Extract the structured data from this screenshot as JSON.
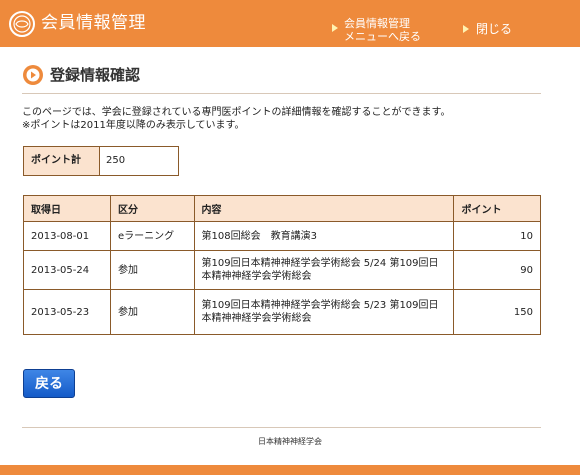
{
  "header": {
    "app_title": "会員情報管理",
    "nav_menu_line1": "会員情報管理",
    "nav_menu_line2": "メニューへ戻る",
    "nav_close": "閉じる"
  },
  "page": {
    "title": "登録情報確認",
    "desc_line1": "このページでは、学会に登録されている専門医ポイントの詳細情報を確認することができます。",
    "desc_line2": "※ポイントは2011年度以降のみ表示しています。"
  },
  "summary": {
    "label": "ポイント計",
    "value": "250"
  },
  "table": {
    "headers": {
      "date": "取得日",
      "kind": "区分",
      "content": "内容",
      "points": "ポイント"
    },
    "rows": [
      {
        "date": "2013-08-01",
        "kind": "eラーニング",
        "content": "第108回総会　教育講演3",
        "points": "10"
      },
      {
        "date": "2013-05-24",
        "kind": "参加",
        "content": "第109回日本精神神経学会学術総会 5/24 第109回日本精神神経学会学術総会",
        "points": "90"
      },
      {
        "date": "2013-05-23",
        "kind": "参加",
        "content": "第109回日本精神神経学会学術総会 5/23 第109回日本精神神経学会学術総会",
        "points": "150"
      }
    ]
  },
  "buttons": {
    "back": "戻る"
  },
  "footer": {
    "text": "日本精神神経学会"
  },
  "colors": {
    "header_bg": "#ee8a3c",
    "table_header_bg": "#fbe3cf",
    "table_border": "#8a5a2a",
    "button_blue": "#145bc8"
  },
  "icons": {
    "logo": "society-logo-icon",
    "title": "arrow-circle-icon",
    "nav": "triangle-right-icon"
  }
}
